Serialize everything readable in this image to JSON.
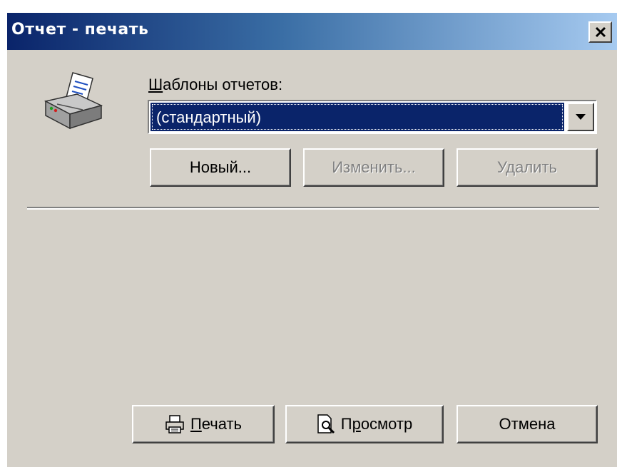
{
  "window": {
    "title": "Отчет - печать",
    "close_glyph": "×"
  },
  "templates": {
    "label_mnemonic": "Ш",
    "label_rest": "аблоны отчетов:",
    "selected_value": "(стандартный)",
    "icon": "printer-icon"
  },
  "template_buttons": {
    "new_label": "Новый...",
    "edit_label": "Изменить...",
    "delete_label": "Удалить"
  },
  "actions": {
    "print_mnemonic": "П",
    "print_rest": "ечать",
    "preview_prefix": "П",
    "preview_mnemonic": "р",
    "preview_rest": "осмотр",
    "cancel_label": "Отмена"
  },
  "colors": {
    "dialog_bg": "#d4d0c8",
    "title_gradient_start": "#0a246a",
    "title_gradient_end": "#a6caf0",
    "selection_bg": "#0a246a",
    "disabled_text": "#808080"
  }
}
